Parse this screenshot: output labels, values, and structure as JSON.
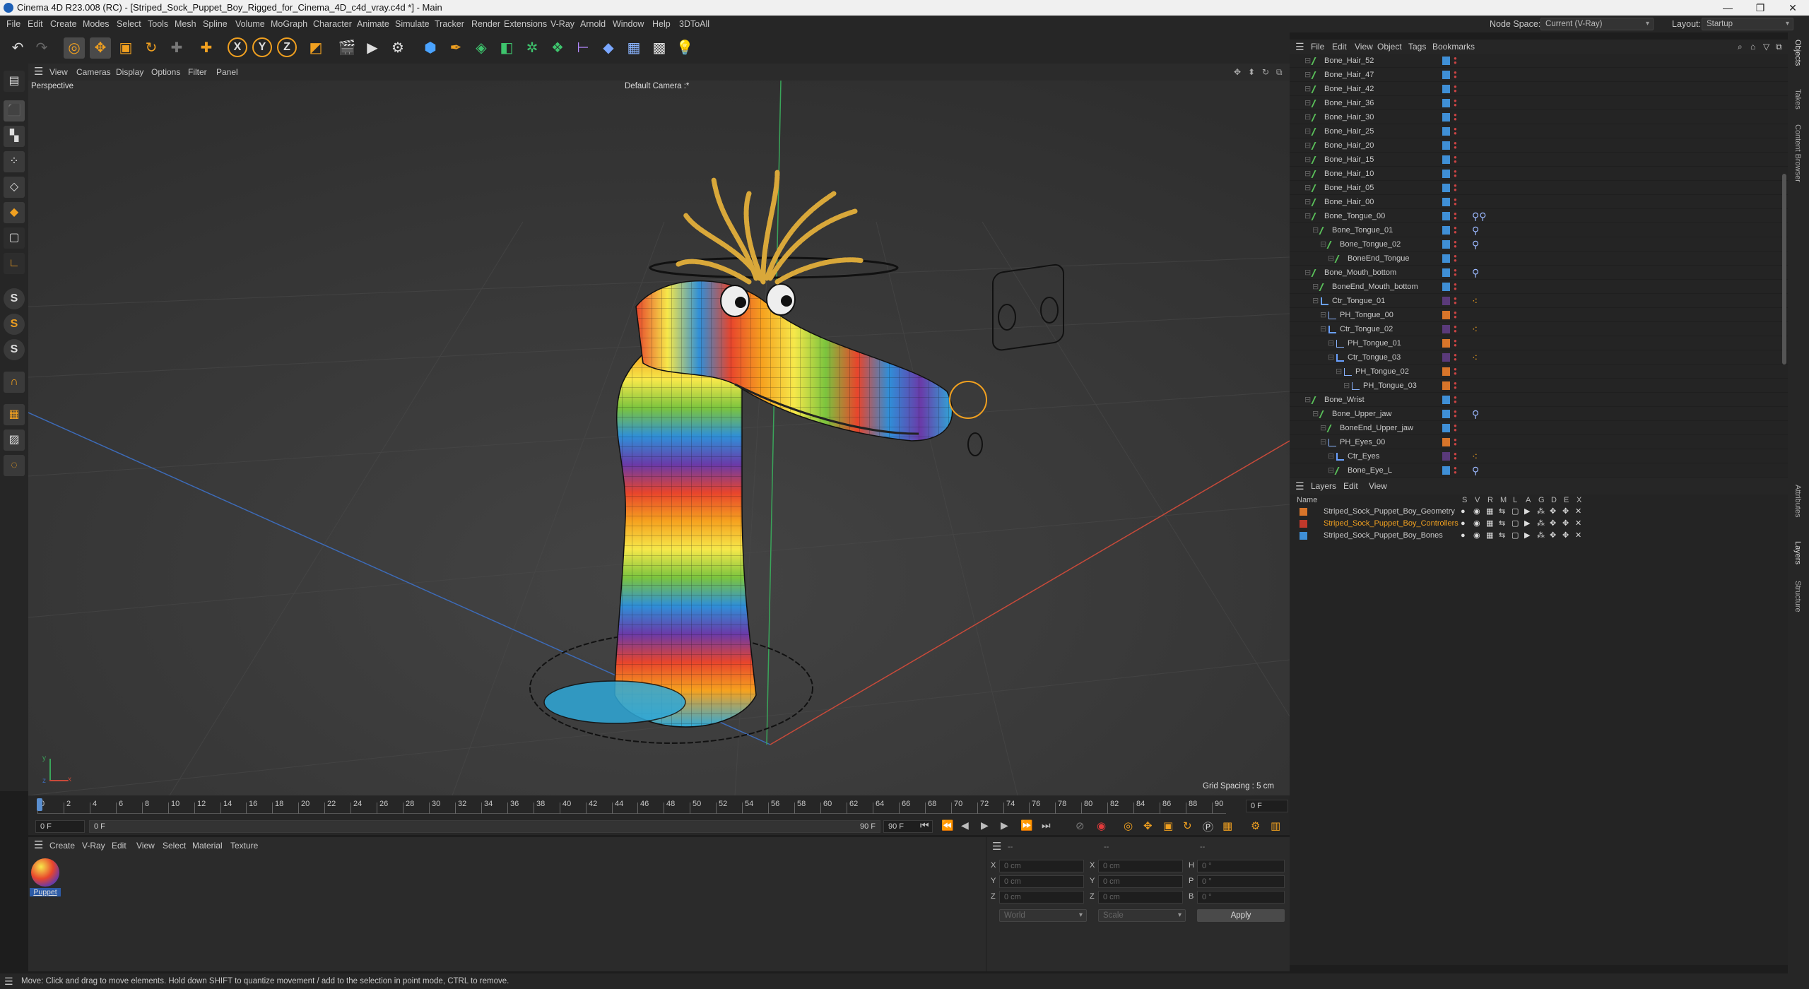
{
  "window": {
    "title": "Cinema 4D R23.008 (RC) - [Striped_Sock_Puppet_Boy_Rigged_for_Cinema_4D_c4d_vray.c4d *] - Main",
    "controls": [
      "—",
      "❐",
      "✕"
    ]
  },
  "menubar": {
    "items": [
      "File",
      "Edit",
      "Create",
      "Modes",
      "Select",
      "Tools",
      "Mesh",
      "Spline",
      "Volume",
      "MoGraph",
      "Character",
      "Animate",
      "Simulate",
      "Tracker",
      "Render",
      "Extensions",
      "V-Ray",
      "Arnold",
      "Window",
      "Help",
      "3DToAll"
    ],
    "node_space_label": "Node Space:",
    "node_space_value": "Current (V-Ray)",
    "layout_label": "Layout:",
    "layout_value": "Startup"
  },
  "toolbar": {
    "axis_x": "X",
    "axis_y": "Y",
    "axis_z": "Z"
  },
  "viewport": {
    "menu": [
      "View",
      "Cameras",
      "Display",
      "Options",
      "Filter",
      "Panel"
    ],
    "label": "Perspective",
    "camera": "Default Camera :*",
    "grid_spacing": "Grid Spacing : 5 cm",
    "axis_y": "y",
    "axis_x": "x",
    "axis_z": "z"
  },
  "timeline": {
    "ticks": [
      "0",
      "2",
      "4",
      "6",
      "8",
      "10",
      "12",
      "14",
      "16",
      "18",
      "20",
      "22",
      "24",
      "26",
      "28",
      "30",
      "32",
      "34",
      "36",
      "38",
      "40",
      "42",
      "44",
      "46",
      "48",
      "50",
      "52",
      "54",
      "56",
      "58",
      "60",
      "62",
      "64",
      "66",
      "68",
      "70",
      "72",
      "74",
      "76",
      "78",
      "80",
      "82",
      "84",
      "86",
      "88",
      "90"
    ],
    "current_frame": "0 F",
    "start_field": "0 F",
    "range_start": "0 F",
    "range_end": "90 F",
    "end_field": "90 F"
  },
  "materials": {
    "menu": [
      "Create",
      "V-Ray",
      "Edit",
      "View",
      "Select",
      "Material",
      "Texture"
    ],
    "items": [
      {
        "label": "Puppet"
      }
    ]
  },
  "coords": {
    "header": [
      "--",
      "--",
      "--"
    ],
    "rows": [
      {
        "a": "X",
        "av": "0 cm",
        "b": "X",
        "bv": "0 cm",
        "c": "H",
        "cv": "0 °"
      },
      {
        "a": "Y",
        "av": "0 cm",
        "b": "Y",
        "bv": "0 cm",
        "c": "P",
        "cv": "0 °"
      },
      {
        "a": "Z",
        "av": "0 cm",
        "b": "Z",
        "bv": "0 cm",
        "c": "B",
        "cv": "0 °"
      }
    ],
    "world": "World",
    "scale": "Scale",
    "apply": "Apply"
  },
  "objects": {
    "menu": [
      "File",
      "Edit",
      "View",
      "Object",
      "Tags",
      "Bookmarks"
    ],
    "rows": [
      {
        "name": "Bone_Hair_52",
        "indent": 1,
        "kind": "bone",
        "color": "#3f8fd6",
        "tag": ""
      },
      {
        "name": "Bone_Hair_47",
        "indent": 1,
        "kind": "bone",
        "color": "#3f8fd6",
        "tag": ""
      },
      {
        "name": "Bone_Hair_42",
        "indent": 1,
        "kind": "bone",
        "color": "#3f8fd6",
        "tag": ""
      },
      {
        "name": "Bone_Hair_36",
        "indent": 1,
        "kind": "bone",
        "color": "#3f8fd6",
        "tag": ""
      },
      {
        "name": "Bone_Hair_30",
        "indent": 1,
        "kind": "bone",
        "color": "#3f8fd6",
        "tag": ""
      },
      {
        "name": "Bone_Hair_25",
        "indent": 1,
        "kind": "bone",
        "color": "#3f8fd6",
        "tag": ""
      },
      {
        "name": "Bone_Hair_20",
        "indent": 1,
        "kind": "bone",
        "color": "#3f8fd6",
        "tag": ""
      },
      {
        "name": "Bone_Hair_15",
        "indent": 1,
        "kind": "bone",
        "color": "#3f8fd6",
        "tag": ""
      },
      {
        "name": "Bone_Hair_10",
        "indent": 1,
        "kind": "bone",
        "color": "#3f8fd6",
        "tag": ""
      },
      {
        "name": "Bone_Hair_05",
        "indent": 1,
        "kind": "bone",
        "color": "#3f8fd6",
        "tag": ""
      },
      {
        "name": "Bone_Hair_00",
        "indent": 1,
        "kind": "bone",
        "color": "#3f8fd6",
        "tag": ""
      },
      {
        "name": "Bone_Tongue_00",
        "indent": 1,
        "kind": "bone",
        "color": "#3f8fd6",
        "tag": "weights2"
      },
      {
        "name": "Bone_Tongue_01",
        "indent": 2,
        "kind": "bone",
        "color": "#3f8fd6",
        "tag": "weights"
      },
      {
        "name": "Bone_Tongue_02",
        "indent": 3,
        "kind": "bone",
        "color": "#3f8fd6",
        "tag": "weights"
      },
      {
        "name": "BoneEnd_Tongue",
        "indent": 4,
        "kind": "bone",
        "color": "#3f8fd6",
        "tag": ""
      },
      {
        "name": "Bone_Mouth_bottom",
        "indent": 1,
        "kind": "bone",
        "color": "#3f8fd6",
        "tag": "weights"
      },
      {
        "name": "BoneEnd_Mouth_bottom",
        "indent": 2,
        "kind": "bone",
        "color": "#3f8fd6",
        "tag": ""
      },
      {
        "name": "Ctr_Tongue_01",
        "indent": 2,
        "kind": "ctrl",
        "color": "#5a3a7a",
        "tag": "ctag"
      },
      {
        "name": "PH_Tongue_00",
        "indent": 3,
        "kind": "ph",
        "color": "#d8752a",
        "tag": ""
      },
      {
        "name": "Ctr_Tongue_02",
        "indent": 3,
        "kind": "ctrl",
        "color": "#5a3a7a",
        "tag": "ctag"
      },
      {
        "name": "PH_Tongue_01",
        "indent": 4,
        "kind": "ph",
        "color": "#d8752a",
        "tag": ""
      },
      {
        "name": "Ctr_Tongue_03",
        "indent": 4,
        "kind": "ctrl",
        "color": "#5a3a7a",
        "tag": "ctag"
      },
      {
        "name": "PH_Tongue_02",
        "indent": 5,
        "kind": "ph",
        "color": "#d8752a",
        "tag": ""
      },
      {
        "name": "PH_Tongue_03",
        "indent": 6,
        "kind": "ph",
        "color": "#d8752a",
        "tag": ""
      },
      {
        "name": "Bone_Wrist",
        "indent": 1,
        "kind": "bone",
        "color": "#3f8fd6",
        "tag": ""
      },
      {
        "name": "Bone_Upper_jaw",
        "indent": 2,
        "kind": "bone",
        "color": "#3f8fd6",
        "tag": "weights"
      },
      {
        "name": "BoneEnd_Upper_jaw",
        "indent": 3,
        "kind": "bone",
        "color": "#3f8fd6",
        "tag": ""
      },
      {
        "name": "PH_Eyes_00",
        "indent": 3,
        "kind": "ph",
        "color": "#d8752a",
        "tag": ""
      },
      {
        "name": "Ctr_Eyes",
        "indent": 4,
        "kind": "ctrl",
        "color": "#5a3a7a",
        "tag": "ctag"
      },
      {
        "name": "Bone_Eye_L",
        "indent": 4,
        "kind": "bone",
        "color": "#3f8fd6",
        "tag": "weights"
      }
    ]
  },
  "layers": {
    "menu": [
      "Layers",
      "Edit",
      "View"
    ],
    "columns": {
      "name": "Name",
      "flags": [
        "S",
        "V",
        "R",
        "M",
        "L",
        "A",
        "G",
        "D",
        "E",
        "X"
      ]
    },
    "rows": [
      {
        "name": "Striped_Sock_Puppet_Boy_Geometry",
        "color": "#d8752a",
        "active": false
      },
      {
        "name": "Striped_Sock_Puppet_Boy_Controllers",
        "color": "#c0392b",
        "active": true
      },
      {
        "name": "Striped_Sock_Puppet_Boy_Bones",
        "color": "#3f8fd6",
        "active": false
      }
    ]
  },
  "side_tabs": [
    "Objects",
    "Takes",
    "Content Browser",
    "Attributes",
    "Layers",
    "Structure"
  ],
  "status": {
    "text": "Move: Click and drag to move elements. Hold down SHIFT to quantize movement / add to the selection in point mode, CTRL to remove."
  },
  "colors": {
    "accent": "#f0a020",
    "panel": "#262626",
    "viewport": "#3a3a3a"
  }
}
